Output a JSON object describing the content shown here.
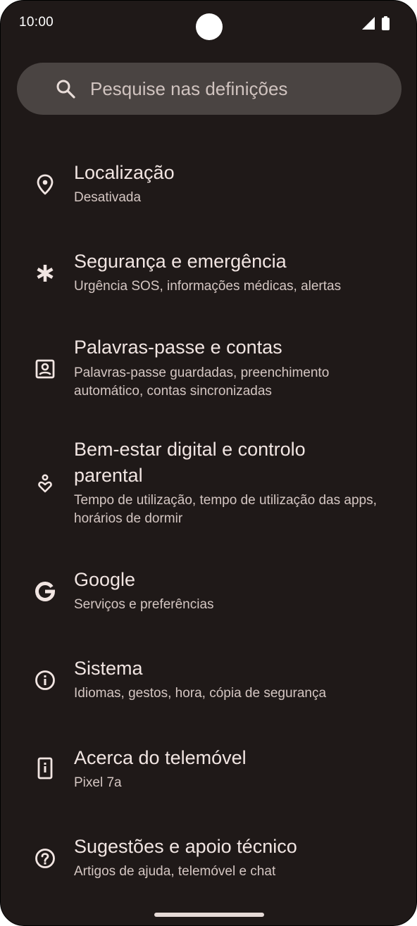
{
  "status_bar": {
    "time": "10:00"
  },
  "search": {
    "placeholder": "Pesquise nas definições",
    "icon": "search-icon"
  },
  "settings": {
    "items": [
      {
        "title": "Localização",
        "subtitle": "Desativada",
        "icon": "location-pin-icon"
      },
      {
        "title": "Segurança e emergência",
        "subtitle": "Urgência SOS, informações médicas, alertas",
        "icon": "asterisk-icon"
      },
      {
        "title": "Palavras-passe e contas",
        "subtitle": "Palavras-passe guardadas, preenchimento automático, contas sincronizadas",
        "icon": "account-box-icon"
      },
      {
        "title": "Bem-estar digital e controlo parental",
        "subtitle": "Tempo de utilização, tempo de utilização das apps, horários de dormir",
        "icon": "wellbeing-icon"
      },
      {
        "title": "Google",
        "subtitle": "Serviços e preferências",
        "icon": "google-icon"
      },
      {
        "title": "Sistema",
        "subtitle": "Idiomas, gestos, hora, cópia de segurança",
        "icon": "info-icon"
      },
      {
        "title": "Acerca do telemóvel",
        "subtitle": "Pixel 7a",
        "icon": "phone-info-icon"
      },
      {
        "title": "Sugestões e apoio técnico",
        "subtitle": "Artigos de ajuda, telemóvel e chat",
        "icon": "help-icon"
      }
    ]
  },
  "colors": {
    "background": "#1f1918",
    "search_bg": "#4a4442",
    "title_text": "#f1e5e2",
    "subtitle_text": "#d4c6c2"
  }
}
